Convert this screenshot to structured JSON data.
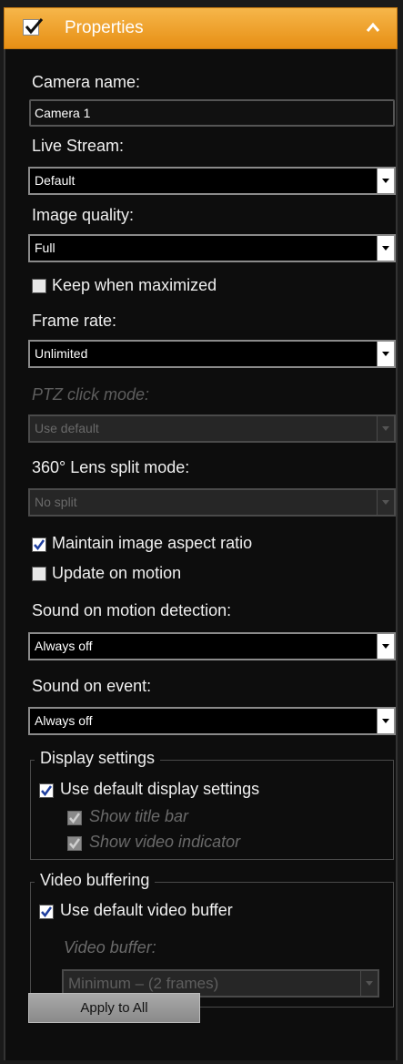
{
  "header": {
    "title": "Properties",
    "checked": true
  },
  "camera_name": {
    "label": "Camera name:",
    "value": "Camera 1"
  },
  "live_stream": {
    "label": "Live Stream:",
    "value": "Default"
  },
  "image_quality": {
    "label": "Image quality:",
    "value": "Full"
  },
  "keep_maximized": {
    "label": "Keep when maximized",
    "checked": false
  },
  "frame_rate": {
    "label": "Frame rate:",
    "value": "Unlimited"
  },
  "ptz_click_mode": {
    "label": "PTZ click mode:",
    "value": "Use default",
    "disabled": true
  },
  "lens_split_mode": {
    "label": "360° Lens split mode:",
    "value": "No split",
    "disabled": true
  },
  "maintain_aspect": {
    "label": "Maintain image aspect ratio",
    "checked": true
  },
  "update_motion": {
    "label": "Update on motion",
    "checked": false
  },
  "sound_motion": {
    "label": "Sound on motion detection:",
    "value": "Always off"
  },
  "sound_event": {
    "label": "Sound on event:",
    "value": "Always off"
  },
  "display_settings": {
    "legend": "Display settings",
    "use_default": {
      "label": "Use default display settings",
      "checked": true
    },
    "show_title_bar": {
      "label": "Show title bar",
      "checked": true,
      "disabled": true
    },
    "show_video_indicator": {
      "label": "Show video indicator",
      "checked": true,
      "disabled": true
    }
  },
  "video_buffering": {
    "legend": "Video buffering",
    "use_default": {
      "label": "Use default video buffer",
      "checked": true
    },
    "buffer_label": "Video buffer:",
    "buffer_value": "Minimum – (2 frames)"
  },
  "apply_button": "Apply to All",
  "colors": {
    "header": "#f0a030",
    "panel": "#0d0d0d",
    "checkmark": "#1f3f9f"
  }
}
